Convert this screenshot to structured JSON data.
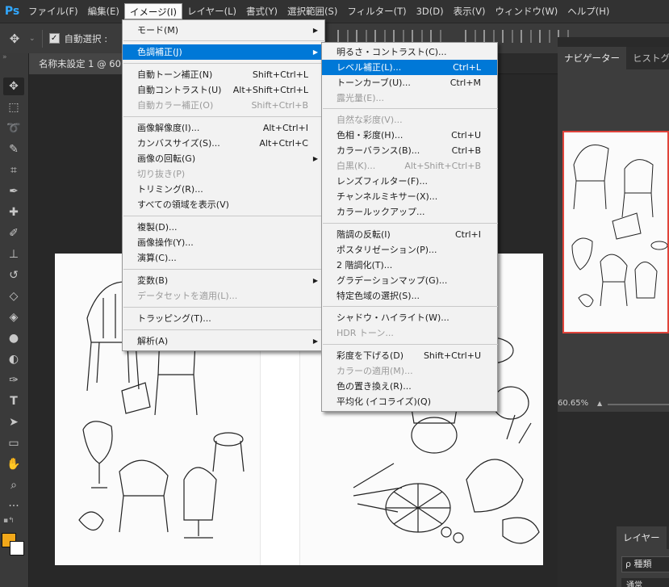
{
  "app": {
    "logo": "Ps"
  },
  "menubar": [
    "ファイル(F)",
    "編集(E)",
    "イメージ(I)",
    "レイヤー(L)",
    "書式(Y)",
    "選択範囲(S)",
    "フィルター(T)",
    "3D(D)",
    "表示(V)",
    "ウィンドウ(W)",
    "ヘルプ(H)"
  ],
  "options": {
    "auto_select": "自動選択 :"
  },
  "document_tab": "名称未設定 1 @ 60",
  "navigator": {
    "tabs": [
      "ナビゲーター",
      "ヒストグラム"
    ],
    "zoom": "60.65%"
  },
  "layers": {
    "tab": "レイヤー",
    "kind": "ρ 種類",
    "mode": "通常"
  },
  "colors": {
    "foreground": "#f2a81a",
    "background": "#ffffff",
    "highlight": "#0078d7"
  },
  "image_menu": {
    "items": [
      {
        "label": "モード(M)",
        "arrow": true
      },
      {
        "label": "色調補正(J)",
        "arrow": true,
        "highlighted": true
      },
      {
        "label": "自動トーン補正(N)",
        "shortcut": "Shift+Ctrl+L"
      },
      {
        "label": "自動コントラスト(U)",
        "shortcut": "Alt+Shift+Ctrl+L"
      },
      {
        "label": "自動カラー補正(O)",
        "shortcut": "Shift+Ctrl+B",
        "disabled": true
      },
      {
        "label": "画像解像度(I)...",
        "shortcut": "Alt+Ctrl+I"
      },
      {
        "label": "カンバスサイズ(S)...",
        "shortcut": "Alt+Ctrl+C"
      },
      {
        "label": "画像の回転(G)",
        "arrow": true
      },
      {
        "label": "切り抜き(P)",
        "disabled": true
      },
      {
        "label": "トリミング(R)..."
      },
      {
        "label": "すべての領域を表示(V)"
      },
      {
        "label": "複製(D)..."
      },
      {
        "label": "画像操作(Y)..."
      },
      {
        "label": "演算(C)..."
      },
      {
        "label": "変数(B)",
        "arrow": true
      },
      {
        "label": "データセットを適用(L)...",
        "disabled": true
      },
      {
        "label": "トラッピング(T)..."
      },
      {
        "label": "解析(A)",
        "arrow": true
      }
    ]
  },
  "adjust_menu": {
    "items": [
      {
        "label": "明るさ・コントラスト(C)..."
      },
      {
        "label": "レベル補正(L)...",
        "shortcut": "Ctrl+L",
        "highlighted": true
      },
      {
        "label": "トーンカーブ(U)...",
        "shortcut": "Ctrl+M"
      },
      {
        "label": "露光量(E)...",
        "disabled": true
      },
      {
        "label": "自然な彩度(V)...",
        "disabled": true
      },
      {
        "label": "色相・彩度(H)...",
        "shortcut": "Ctrl+U"
      },
      {
        "label": "カラーバランス(B)...",
        "shortcut": "Ctrl+B"
      },
      {
        "label": "白黒(K)...",
        "shortcut": "Alt+Shift+Ctrl+B",
        "disabled": true
      },
      {
        "label": "レンズフィルター(F)..."
      },
      {
        "label": "チャンネルミキサー(X)..."
      },
      {
        "label": "カラールックアップ..."
      },
      {
        "label": "階調の反転(I)",
        "shortcut": "Ctrl+I"
      },
      {
        "label": "ポスタリゼーション(P)..."
      },
      {
        "label": "2 階調化(T)..."
      },
      {
        "label": "グラデーションマップ(G)..."
      },
      {
        "label": "特定色域の選択(S)..."
      },
      {
        "label": "シャドウ・ハイライト(W)..."
      },
      {
        "label": "HDR トーン...",
        "disabled": true
      },
      {
        "label": "彩度を下げる(D)",
        "shortcut": "Shift+Ctrl+U"
      },
      {
        "label": "カラーの適用(M)...",
        "disabled": true
      },
      {
        "label": "色の置き換え(R)..."
      },
      {
        "label": "平均化 (イコライズ)(Q)"
      }
    ]
  }
}
